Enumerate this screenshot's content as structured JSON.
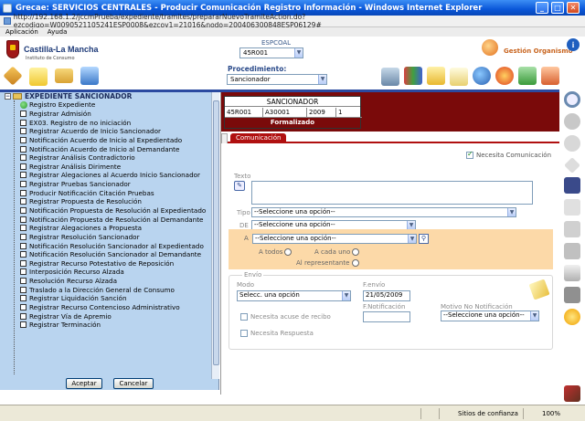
{
  "window": {
    "title": "Grecae: SERVICIOS CENTRALES - Producir Comunicación Registro Información - Windows Internet Explorer",
    "url": "http://192.168.1.2/jccmPrueba/expediente/tramites/prepararNuevoTramiteAction.do?ezcodigo=W0090521105241ESP0008&ezcoy1=21016&nodo=200406300848ESP06129#",
    "menu": [
      "Aplicación",
      "Ayuda"
    ]
  },
  "header": {
    "logo_text": "Castilla-La Mancha",
    "logo_sub": "Instituto de Consumo",
    "espcoal_label": "ESPCOAL",
    "espcoal_value": "45R001",
    "gestion_label": "Gestión Organismo",
    "procedimiento_label": "Procedimiento:",
    "procedimiento_value": "Sancionador"
  },
  "expediente": {
    "title": "SANCIONADOR",
    "cells": [
      "45R001",
      "A30001",
      "2009",
      "1"
    ],
    "state": "Formalizado"
  },
  "tree": {
    "root_label": "EXPEDIENTE SANCIONADOR",
    "items": [
      "Registro Expediente",
      "Registrar Admisión",
      "EX03. Registro de no iniciación",
      "Registrar Acuerdo de Inicio Sancionador",
      "Notificación Acuerdo de Inicio al Expedientado",
      "Notificación Acuerdo de Inicio al Demandante",
      "Registrar Análisis Contradictorio",
      "Registrar Análisis Dirimente",
      "Registrar Alegaciones al Acuerdo Inicio Sancionador",
      "Registrar Pruebas Sancionador",
      "Producir Notificación Citación Pruebas",
      "Registrar Propuesta de Resolución",
      "Notificación Propuesta de Resolución al Expedientado",
      "Notificación Propuesta de Resolución al Demandante",
      "Registrar Alegaciones a Propuesta",
      "Registrar Resolución Sancionador",
      "Notificación Resolución Sancionador al Expedientado",
      "Notificación Resolución Sancionador al Demandante",
      "Registrar Recurso Potestativo de Reposición",
      "Interposición Recurso Alzada",
      "Resolución Recurso Alzada",
      "Traslado a la Dirección General de Consumo",
      "Registrar Liquidación Sanción",
      "Registrar Recurso Contencioso Administrativo",
      "Registrar Vía de Apremio",
      "Registrar Terminación"
    ],
    "accept_label": "Aceptar",
    "cancel_label": "Cancelar"
  },
  "form": {
    "tab_label": "Comunicación",
    "necesita_comunicacion": "Necesita Comunicación",
    "texto_label": "Texto",
    "tipo_label": "Tipo",
    "tipo_value": "--Seleccione una opción--",
    "de_label": "DE",
    "de_value": "--Seleccione una opción--",
    "a_label": "A",
    "a_value": "--Seleccione una opción--",
    "a_todos": "A todos",
    "a_cada_uno": "A cada uno",
    "al_representante": "Al representante",
    "envio_label": "Envío",
    "modo_label": "Modo",
    "modo_value": "Selecc. una opción",
    "fenvio_label": "F.envío",
    "fenvio_value": "21/05/2009",
    "acuse_label": "Necesita acuse de recibo",
    "fnotif_label": "F.Notificación",
    "motivo_label": "Motivo No Notificación",
    "motivo_value": "--Seleccione una opción--",
    "respuesta_label": "Necesita Respuesta"
  },
  "status": {
    "zone": "Sitios de confianza",
    "zoom": "100%"
  }
}
